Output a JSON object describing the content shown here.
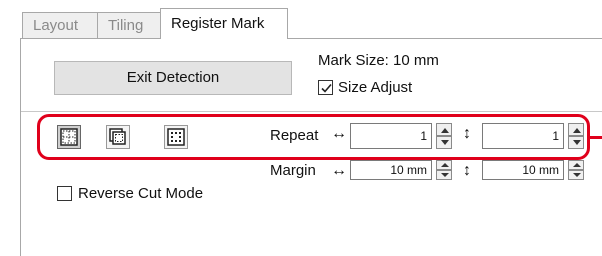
{
  "tabs": {
    "layout": "Layout",
    "tiling": "Tiling",
    "register_mark": "Register Mark",
    "active": "register_mark"
  },
  "exit_button": {
    "label": "Exit Detection"
  },
  "mark_size": {
    "label": "Mark Size:",
    "value": "10 mm"
  },
  "size_adjust": {
    "label": "Size Adjust",
    "checked": true
  },
  "mark_type_buttons": [
    {
      "icon": "grid-mark-icon",
      "selected": true
    },
    {
      "icon": "stacked-pages-icon",
      "selected": false
    },
    {
      "icon": "corner-dots-icon",
      "selected": false
    }
  ],
  "repeat": {
    "label": "Repeat",
    "horizontal_symbol": "↔",
    "vertical_symbol": "↕",
    "horizontal_value": "1",
    "vertical_value": "1"
  },
  "margin": {
    "label": "Margin",
    "horizontal_symbol": "↔",
    "vertical_symbol": "↕",
    "horizontal_value": "10 mm",
    "vertical_value": "10 mm"
  },
  "reverse_cut_mode": {
    "label": "Reverse Cut Mode",
    "checked": false
  },
  "colors": {
    "highlight": "#e0001b",
    "selected_button": "#cfcfcf"
  }
}
